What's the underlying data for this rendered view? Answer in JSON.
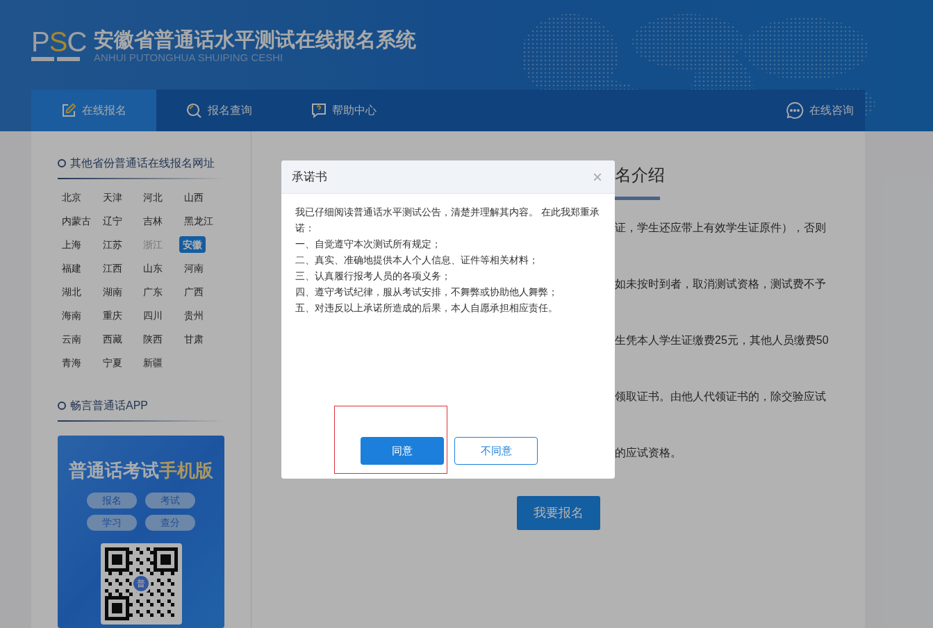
{
  "header": {
    "logo": {
      "letters": [
        "P",
        "S",
        "C"
      ]
    },
    "title": "安徽省普通话水平测试在线报名系统",
    "subtitle": "ANHUI PUTONGHUA SHUIPING CESHI"
  },
  "nav": {
    "tabs": [
      {
        "label": "在线报名",
        "selected": true
      },
      {
        "label": "报名查询",
        "selected": false
      },
      {
        "label": "帮助中心",
        "selected": false
      }
    ],
    "consult": {
      "label": "在线咨询"
    }
  },
  "sidebar": {
    "provinces_heading": "其他省份普通话在线报名网址",
    "provinces": [
      {
        "name": "北京",
        "selected": false,
        "disabled": false
      },
      {
        "name": "天津",
        "selected": false,
        "disabled": false
      },
      {
        "name": "河北",
        "selected": false,
        "disabled": false
      },
      {
        "name": "山西",
        "selected": false,
        "disabled": false
      },
      {
        "name": "内蒙古",
        "selected": false,
        "disabled": false
      },
      {
        "name": "辽宁",
        "selected": false,
        "disabled": false
      },
      {
        "name": "吉林",
        "selected": false,
        "disabled": false
      },
      {
        "name": "黑龙江",
        "selected": false,
        "disabled": false
      },
      {
        "name": "上海",
        "selected": false,
        "disabled": false
      },
      {
        "name": "江苏",
        "selected": false,
        "disabled": false
      },
      {
        "name": "浙江",
        "selected": false,
        "disabled": true
      },
      {
        "name": "安徽",
        "selected": true,
        "disabled": false
      },
      {
        "name": "福建",
        "selected": false,
        "disabled": false
      },
      {
        "name": "江西",
        "selected": false,
        "disabled": false
      },
      {
        "name": "山东",
        "selected": false,
        "disabled": false
      },
      {
        "name": "河南",
        "selected": false,
        "disabled": false
      },
      {
        "name": "湖北",
        "selected": false,
        "disabled": false
      },
      {
        "name": "湖南",
        "selected": false,
        "disabled": false
      },
      {
        "name": "广东",
        "selected": false,
        "disabled": false
      },
      {
        "name": "广西",
        "selected": false,
        "disabled": false
      },
      {
        "name": "海南",
        "selected": false,
        "disabled": false
      },
      {
        "name": "重庆",
        "selected": false,
        "disabled": false
      },
      {
        "name": "四川",
        "selected": false,
        "disabled": false
      },
      {
        "name": "贵州",
        "selected": false,
        "disabled": false
      },
      {
        "name": "云南",
        "selected": false,
        "disabled": false
      },
      {
        "name": "西藏",
        "selected": false,
        "disabled": false
      },
      {
        "name": "陕西",
        "selected": false,
        "disabled": false
      },
      {
        "name": "甘肃",
        "selected": false,
        "disabled": false
      },
      {
        "name": "青海",
        "selected": false,
        "disabled": false
      },
      {
        "name": "宁夏",
        "selected": false,
        "disabled": false
      },
      {
        "name": "新疆",
        "selected": false,
        "disabled": false
      }
    ],
    "app_heading": "畅言普通话APP",
    "app_card": {
      "title_main": "普通话考试",
      "title_accent": "手机版",
      "pills": [
        "报名",
        "考试",
        "学习",
        "查分"
      ],
      "qr_center": "普"
    }
  },
  "main": {
    "title": "名介绍",
    "lines": [
      "证，学生还应带上有效学生证原件），否则",
      "如未按时到者，取消测试资格，测试费不予",
      "生凭本人学生证缴费25元，其他人员缴费50",
      "领取证书。由他人代领证书的，除交验应试",
      "的应试资格。"
    ],
    "register_button": "我要报名"
  },
  "dialog": {
    "title": "承诺书",
    "close": "×",
    "paragraphs": [
      "我已仔细阅读普通话水平测试公告，清楚并理解其内容。 在此我郑重承诺：",
      "一、自觉遵守本次测试所有规定；",
      "二、真实、准确地提供本人个人信息、证件等相关材料；",
      "三、认真履行报考人员的各项义务；",
      "四、遵守考试纪律，服从考试安排，不舞弊或协助他人舞弊；",
      "五、对违反以上承诺所造成的后果，本人自愿承担相应责任。"
    ],
    "buttons": [
      {
        "label": "同意",
        "kind": "primary",
        "highlighted": true
      },
      {
        "label": "不同意",
        "kind": "outline",
        "highlighted": false
      }
    ]
  }
}
